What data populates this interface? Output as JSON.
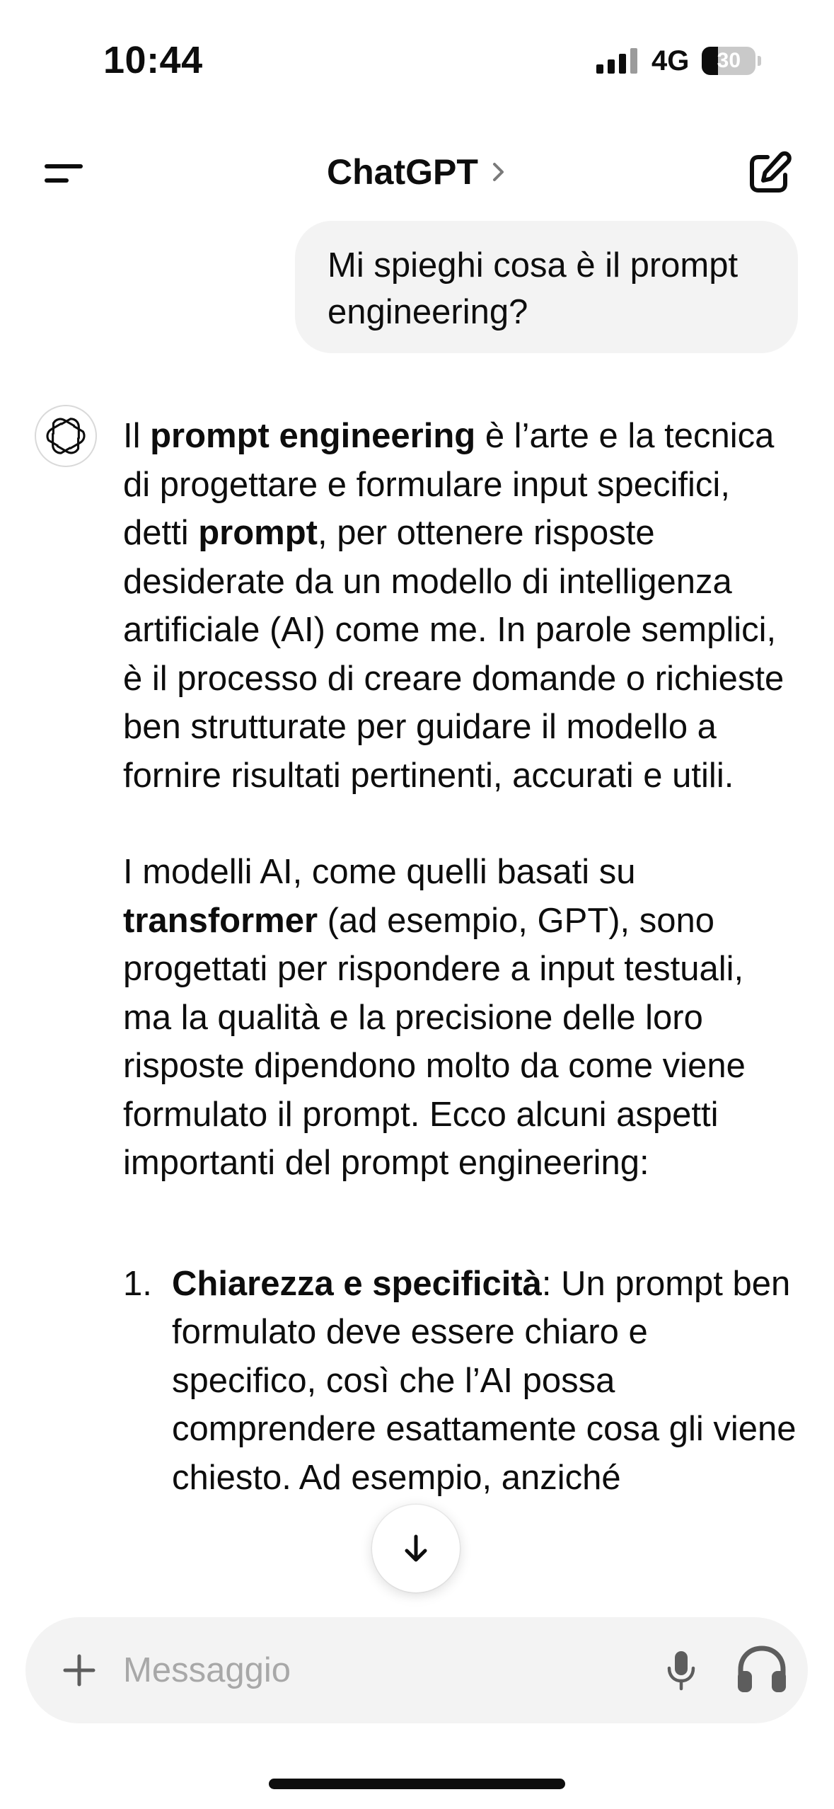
{
  "status_bar": {
    "time": "10:44",
    "network": "4G",
    "battery_level": "30",
    "battery_fraction": 0.3
  },
  "header": {
    "title": "ChatGPT",
    "menu_icon": "menu-icon",
    "chevron_icon": "chevron-right-icon",
    "new_chat_icon": "compose-icon"
  },
  "conversation": {
    "user_message": "Mi spieghi cosa è il prompt engineering?",
    "assistant_avatar_icon": "openai-logo-icon",
    "assistant_message": {
      "p1": {
        "t1": "Il ",
        "b1": "prompt engineering",
        "t2": " è l’arte e la tecnica di progettare e formulare input specifici, detti ",
        "b2": "prompt",
        "t3": ", per ottenere risposte desiderate da un modello di intelligenza artificiale (AI) come me. In parole semplici, è il processo di creare domande o richieste ben strutturate per guidare il modello a fornire risultati pertinenti, accurati e utili."
      },
      "p2": {
        "t1": "I modelli AI, come quelli basati su ",
        "b1": "transformer",
        "t2": " (ad esempio, GPT), sono progettati per rispondere a input testuali, ma la qualità e la precisione delle loro risposte dipendono molto da come viene formulato il prompt. Ecco alcuni aspetti importanti del prompt engineering:"
      },
      "list": [
        {
          "number": "1.",
          "bold": "Chiarezza e specificità",
          "text": ": Un prompt ben formulato deve essere chiaro e specifico, così che l’AI possa comprendere esattamente cosa gli viene chiesto. Ad esempio, anziché"
        }
      ]
    }
  },
  "scroll_down_icon": "arrow-down-icon",
  "composer": {
    "placeholder": "Messaggio",
    "value": "",
    "plus_icon": "plus-icon",
    "mic_icon": "microphone-icon",
    "voice_icon": "headphones-icon"
  },
  "colors": {
    "text": "#0d0d0d",
    "bubble_bg": "#f3f3f3",
    "placeholder": "#a8a8a8",
    "icon_gray": "#5d5d5d"
  }
}
